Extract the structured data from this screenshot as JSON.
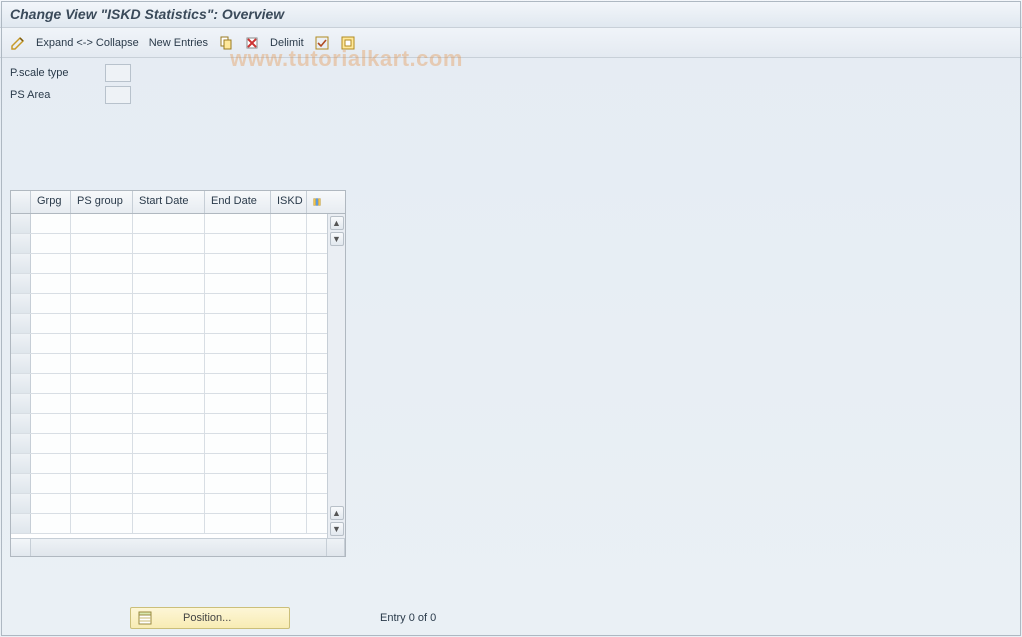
{
  "title": "Change View \"ISKD Statistics\": Overview",
  "toolbar": {
    "expand_collapse": "Expand <-> Collapse",
    "new_entries": "New Entries",
    "delimit": "Delimit"
  },
  "watermark": "www.tutorialkart.com",
  "fields": {
    "pscale_type_label": "P.scale type",
    "pscale_type_value": "",
    "ps_area_label": "PS Area",
    "ps_area_value": ""
  },
  "grid": {
    "columns": {
      "grpg": "Grpg",
      "psgroup": "PS group",
      "start_date": "Start Date",
      "end_date": "End Date",
      "iskd": "ISKD"
    },
    "row_count": 16
  },
  "footer": {
    "position_label": "Position...",
    "entry_text": "Entry 0 of 0"
  }
}
